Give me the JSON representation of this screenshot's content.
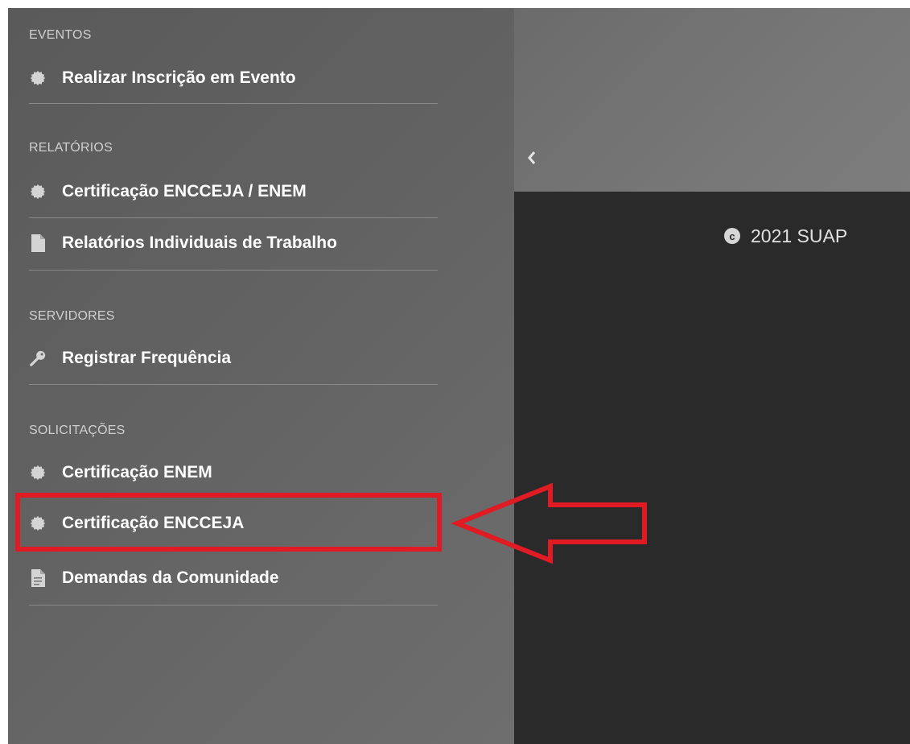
{
  "sidebar": {
    "sections": [
      {
        "title": "EVENTOS",
        "items": [
          {
            "label": "Realizar Inscrição em Evento",
            "icon": "gear-icon"
          }
        ]
      },
      {
        "title": "RELATÓRIOS",
        "items": [
          {
            "label": "Certificação ENCCEJA / ENEM",
            "icon": "gear-icon"
          },
          {
            "label": "Relatórios Individuais de Trabalho",
            "icon": "document-icon"
          }
        ]
      },
      {
        "title": "SERVIDORES",
        "items": [
          {
            "label": "Registrar Frequência",
            "icon": "key-icon"
          }
        ]
      },
      {
        "title": "SOLICITAÇÕES",
        "items": [
          {
            "label": "Certificação ENEM",
            "icon": "gear-icon"
          },
          {
            "label": "Certificação ENCCEJA",
            "icon": "gear-icon"
          },
          {
            "label": "Demandas da Comunidade",
            "icon": "document-text-icon"
          }
        ]
      }
    ]
  },
  "collapse": {
    "icon": "chevron-left-icon"
  },
  "footer": {
    "text": "2021 SUAP",
    "icon": "copyright-icon"
  },
  "annotation": {
    "highlight_color": "#e01b24",
    "arrow_color": "#e01b24"
  }
}
